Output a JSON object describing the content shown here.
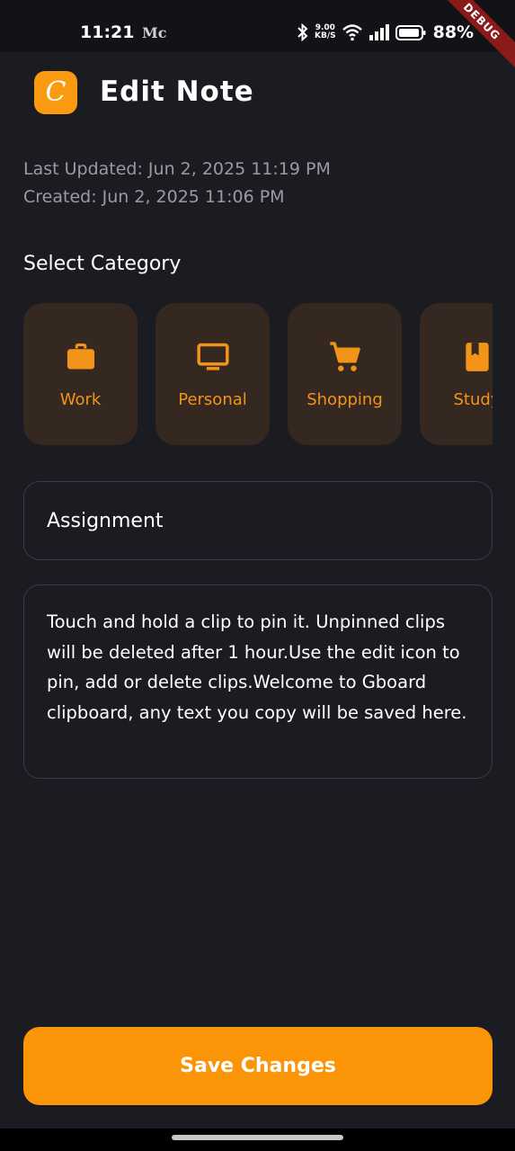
{
  "status_bar": {
    "time": "11:21",
    "app_indicator": "Mc",
    "net_speed_value": "9.00",
    "net_speed_unit": "KB/S",
    "battery_percent": "88%",
    "icons": [
      "bluetooth-icon",
      "wifi-icon",
      "signal-icon",
      "battery-icon"
    ]
  },
  "debug_banner": "DEBUG",
  "header": {
    "logo_letter": "C",
    "title": "Edit Note"
  },
  "meta": {
    "last_updated": "Last Updated: Jun 2, 2025 11:19 PM",
    "created": "Created: Jun 2, 2025 11:06 PM"
  },
  "category_section": {
    "label": "Select Category",
    "items": [
      {
        "label": "Work",
        "icon": "briefcase-icon"
      },
      {
        "label": "Personal",
        "icon": "monitor-icon"
      },
      {
        "label": "Shopping",
        "icon": "cart-icon"
      },
      {
        "label": "Study",
        "icon": "book-icon"
      }
    ]
  },
  "note": {
    "title_value": "Assignment",
    "body_value": "Touch and hold a clip to pin it. Unpinned clips will be deleted after 1 hour.Use the edit icon to pin, add or delete clips.Welcome to Gboard clipboard, any text you copy will be saved here."
  },
  "actions": {
    "save_label": "Save Changes"
  },
  "colors": {
    "background": "#1b1b22",
    "accent": "#fb9508",
    "category_card": "#342820",
    "border": "#3a3a47"
  }
}
